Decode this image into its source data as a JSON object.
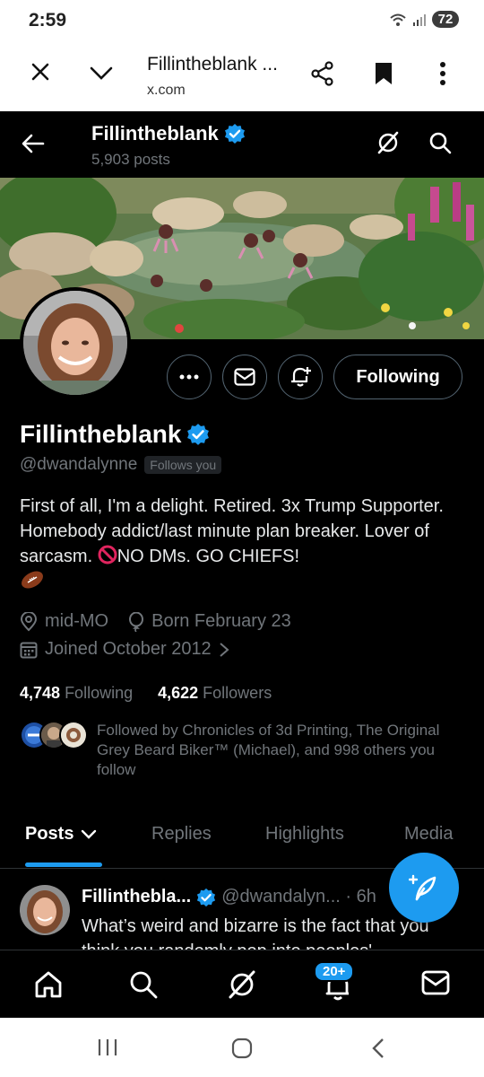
{
  "status_bar": {
    "time": "2:59",
    "battery": "72"
  },
  "browser": {
    "title": "Fillintheblank ...",
    "url": "x.com"
  },
  "header": {
    "name": "Fillintheblank",
    "posts_count": "5,903 posts"
  },
  "profile": {
    "following_button": "Following",
    "name": "Fillintheblank",
    "handle": "@dwandalynne",
    "follows_you": "Follows you",
    "bio_part1": "First of all, I'm a delight. Retired. 3x Trump Supporter.  Homebody addict/last minute plan breaker. Lover of sarcasm. ",
    "bio_part2": "NO DMs. GO CHIEFS!",
    "location": "mid-MO",
    "birthday": "Born February 23",
    "joined": "Joined October 2012",
    "following_count": "4,748",
    "following_label": "Following",
    "followers_count": "4,622",
    "followers_label": "Followers",
    "followed_by": "Followed by Chronicles of 3d Printing, The Original Grey Beard Biker™ (Michael), and 998 others you follow"
  },
  "tabs": [
    {
      "label": "Posts"
    },
    {
      "label": "Replies"
    },
    {
      "label": "Highlights"
    },
    {
      "label": "Media"
    }
  ],
  "post": {
    "name": "Fillintheblа...",
    "handle": "@dwandalyn... · 6h",
    "text": "What’s weird and bizarre is the fact that you think you randomly pop into peoples'"
  },
  "bottom_nav": {
    "notifications_badge": "20+"
  },
  "colors": {
    "accent": "#1d9bf0",
    "background": "#000000",
    "secondary_text": "#71767b"
  }
}
